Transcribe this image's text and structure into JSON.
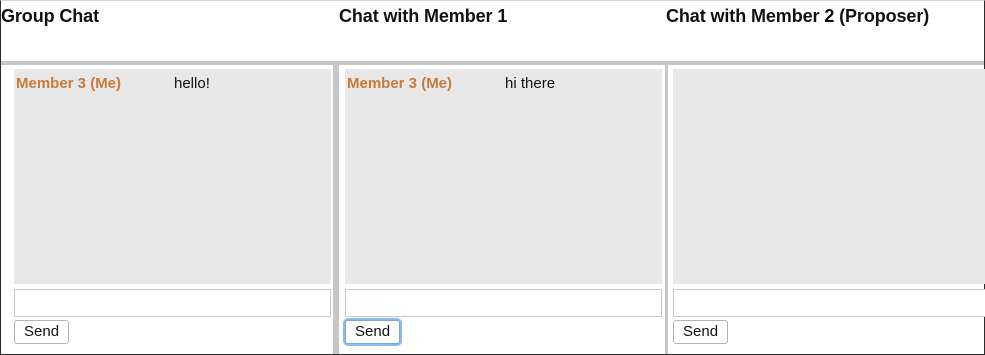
{
  "columns": [
    {
      "title": "Group Chat",
      "messages": [
        {
          "sender": "Member 3 (Me)",
          "text": "hello!"
        }
      ],
      "input_value": "",
      "send_label": "Send"
    },
    {
      "title": "Chat with Member 1",
      "messages": [
        {
          "sender": "Member 3 (Me)",
          "text": "hi there"
        }
      ],
      "input_value": "",
      "send_label": "Send"
    },
    {
      "title": "Chat with Member 2 (Proposer)",
      "messages": [],
      "input_value": "",
      "send_label": "Send"
    }
  ],
  "colors": {
    "sender": "#c87a3c",
    "message_area": "#e8e8e8",
    "divider": "#c7c7c7",
    "focus_ring": "#8cbaf5"
  }
}
